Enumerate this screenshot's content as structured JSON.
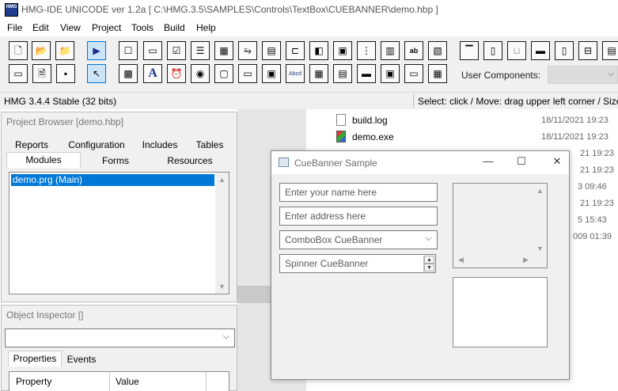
{
  "window": {
    "title": "HMG-IDE  UNICODE  ver 1.2a  [ C:\\HMG.3.5\\SAMPLES\\Controls\\TextBox\\CUEBANNER\\demo.hbp ]",
    "icon_text": "HMG"
  },
  "menu": [
    "File",
    "Edit",
    "View",
    "Project",
    "Tools",
    "Build",
    "Help"
  ],
  "toolbar": {
    "user_components_label": "User Components:",
    "user_components_value": "",
    "buttons_row1": [
      "new-file-icon",
      "open-folder-icon",
      "open-project-icon",
      "run-icon",
      "frame-icon",
      "button-control-icon",
      "checkbox-icon",
      "list-icon",
      "grid-icon",
      "slider-icon",
      "table-icon",
      "label-icon",
      "panel-icon",
      "image-icon",
      "tree-icon",
      "browse-icon",
      "textbox-icon",
      "editbox-icon",
      "timer-icon",
      "property-icon",
      "separator-icon",
      "toolbar-icon",
      "statusbar-icon",
      "menu-icon",
      "context-menu-icon"
    ],
    "buttons_row2": [
      "window-icon",
      "report-icon",
      "form-icon",
      "pointer-icon",
      "multiple-icon",
      "font-icon",
      "clock-icon",
      "radio-icon",
      "animate-icon",
      "tab-icon",
      "player-icon",
      "ip-address-icon",
      "month-calendar-icon",
      "rich-edit-icon",
      "progress-icon",
      "activex-icon",
      "hyperlink-icon",
      "spreadsheet-icon"
    ]
  },
  "status": {
    "left": "HMG 3.4.4 Stable (32 bits)",
    "right": "Select: click / Move: drag upper left corner / Size"
  },
  "explorer": {
    "files": [
      {
        "name": "build.log",
        "date": "18/11/2021 19:23"
      },
      {
        "name": "demo.exe",
        "date": "18/11/2021 19:23"
      }
    ],
    "dates_partial": [
      "21 19:23",
      "21 19:23",
      "3 09:46",
      "21 19:23",
      "5 15:43",
      "009 01:39"
    ]
  },
  "project_browser": {
    "title": "Project Browser [demo.hbp]",
    "tabs_row1": [
      "Reports",
      "Configuration",
      "Includes",
      "Tables"
    ],
    "tabs_row2": [
      "Modules",
      "Forms",
      "Resources"
    ],
    "items": [
      "demo.prg (Main)"
    ]
  },
  "object_inspector": {
    "title": "Object Inspector []",
    "combo_value": "",
    "tabs": [
      "Properties",
      "Events"
    ],
    "columns": [
      "Property",
      "Value"
    ]
  },
  "dialog": {
    "title": "CueBanner Sample",
    "minimize": "—",
    "maximize": "☐",
    "close": "✕",
    "name_placeholder": "Enter your name here",
    "address_placeholder": "Enter address here",
    "combo_cue": "ComboBox CueBanner",
    "spinner_cue": "Spinner CueBanner"
  }
}
